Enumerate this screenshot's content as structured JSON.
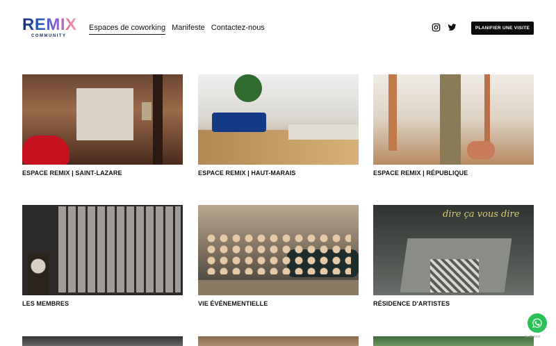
{
  "header": {
    "logo": "REMIX",
    "logo_sub": "COMMUNITY",
    "nav": [
      "Espaces de coworking",
      "Manifeste",
      "Contactez-nous"
    ],
    "cta": "PLANIFIER UNE VISITE",
    "icons": [
      "instagram-icon",
      "twitter-icon"
    ]
  },
  "cards": [
    {
      "title": "ESPACE REMIX | SAINT-LAZARE"
    },
    {
      "title": "ESPACE REMIX | HAUT-MARAIS"
    },
    {
      "title": "ESPACE REMIX | RÉPUBLIQUE"
    },
    {
      "title": "LES MEMBRES"
    },
    {
      "title": "VIE ÉVÉNEMENTIELLE"
    },
    {
      "title": "RÉSIDENCE D'ARTISTES"
    }
  ],
  "residence_sign": "dire ça vous dire",
  "whatsapp": {
    "icon": "whatsapp-icon",
    "label": "GetButton"
  },
  "colors": {
    "cta_bg": "#0b0b0b",
    "whatsapp": "#2bc158",
    "logo_gradient": [
      "#1b2d6b",
      "#2b63c9",
      "#7e5bd6",
      "#e97aa3"
    ]
  }
}
